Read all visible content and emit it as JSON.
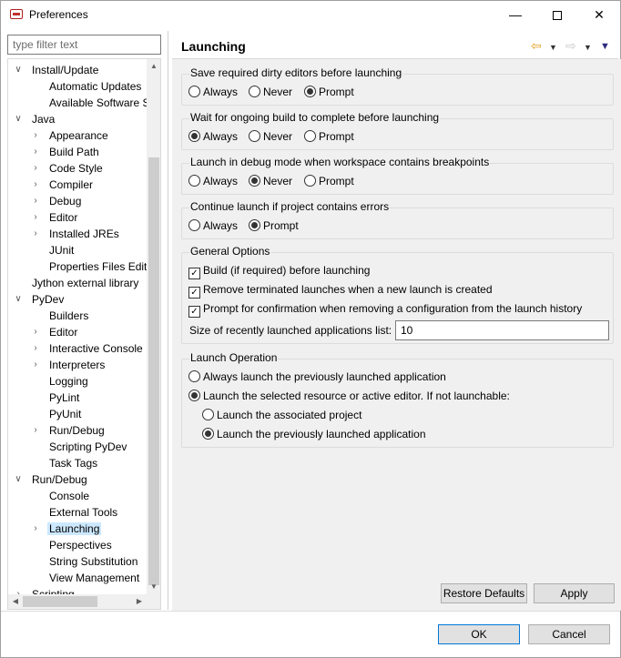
{
  "window": {
    "title": "Preferences"
  },
  "filter": {
    "placeholder": "type filter text"
  },
  "tree": [
    {
      "label": "Install/Update",
      "level": 0,
      "expanded": true
    },
    {
      "label": "Automatic Updates",
      "level": 1
    },
    {
      "label": "Available Software S",
      "level": 1
    },
    {
      "label": "Java",
      "level": 0,
      "expanded": true
    },
    {
      "label": "Appearance",
      "level": 1,
      "collapsed": true
    },
    {
      "label": "Build Path",
      "level": 1,
      "collapsed": true
    },
    {
      "label": "Code Style",
      "level": 1,
      "collapsed": true
    },
    {
      "label": "Compiler",
      "level": 1,
      "collapsed": true
    },
    {
      "label": "Debug",
      "level": 1,
      "collapsed": true
    },
    {
      "label": "Editor",
      "level": 1,
      "collapsed": true
    },
    {
      "label": "Installed JREs",
      "level": 1,
      "collapsed": true
    },
    {
      "label": "JUnit",
      "level": 1
    },
    {
      "label": "Properties Files Edito",
      "level": 1
    },
    {
      "label": "Jython external library",
      "level": 0
    },
    {
      "label": "PyDev",
      "level": 0,
      "expanded": true
    },
    {
      "label": "Builders",
      "level": 1
    },
    {
      "label": "Editor",
      "level": 1,
      "collapsed": true
    },
    {
      "label": "Interactive Console",
      "level": 1,
      "collapsed": true
    },
    {
      "label": "Interpreters",
      "level": 1,
      "collapsed": true
    },
    {
      "label": "Logging",
      "level": 1
    },
    {
      "label": "PyLint",
      "level": 1
    },
    {
      "label": "PyUnit",
      "level": 1
    },
    {
      "label": "Run/Debug",
      "level": 1,
      "collapsed": true
    },
    {
      "label": "Scripting PyDev",
      "level": 1
    },
    {
      "label": "Task Tags",
      "level": 1
    },
    {
      "label": "Run/Debug",
      "level": 0,
      "expanded": true
    },
    {
      "label": "Console",
      "level": 1
    },
    {
      "label": "External Tools",
      "level": 1
    },
    {
      "label": "Launching",
      "level": 1,
      "collapsed": true,
      "selected": true
    },
    {
      "label": "Perspectives",
      "level": 1
    },
    {
      "label": "String Substitution",
      "level": 1
    },
    {
      "label": "View Management",
      "level": 1
    },
    {
      "label": "Scripting",
      "level": 0,
      "collapsed": true
    }
  ],
  "page": {
    "title": "Launching",
    "groups": {
      "dirty_editors": {
        "label": "Save required dirty editors before launching",
        "options": [
          "Always",
          "Never",
          "Prompt"
        ],
        "selected": "Prompt"
      },
      "ongoing_build": {
        "label": "Wait for ongoing build to complete before launching",
        "options": [
          "Always",
          "Never",
          "Prompt"
        ],
        "selected": "Always"
      },
      "debug_mode": {
        "label": "Launch in debug mode when workspace contains breakpoints",
        "options": [
          "Always",
          "Never",
          "Prompt"
        ],
        "selected": "Never"
      },
      "project_errors": {
        "label": "Continue launch if project contains errors",
        "options": [
          "Always",
          "Prompt"
        ],
        "selected": "Prompt"
      }
    },
    "general": {
      "label": "General Options",
      "build_before": "Build (if required) before launching",
      "remove_terminated": "Remove terminated launches when a new launch is created",
      "prompt_confirm": "Prompt for confirmation when removing a configuration from the launch history",
      "history_size_label": "Size of recently launched applications list:",
      "history_size_value": "10"
    },
    "launch_operation": {
      "label": "Launch Operation",
      "always_previous": "Always launch the previously launched application",
      "selected_resource": "Launch the selected resource or active editor. If not launchable:",
      "associated_project": "Launch the associated project",
      "previous_app": "Launch the previously launched application"
    }
  },
  "buttons": {
    "restore_defaults": "Restore Defaults",
    "apply": "Apply",
    "ok": "OK",
    "cancel": "Cancel"
  }
}
